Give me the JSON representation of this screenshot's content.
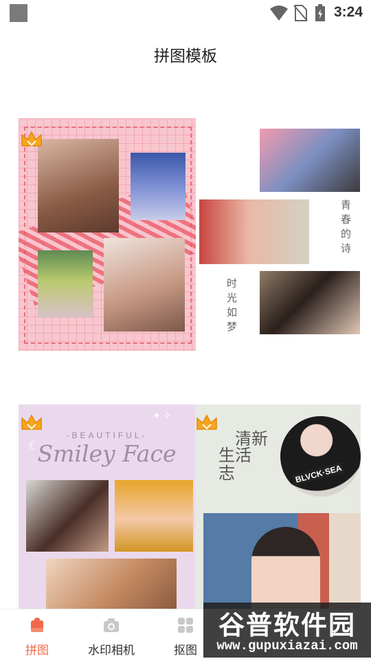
{
  "status_bar": {
    "time": "3:24"
  },
  "header": {
    "title": "拼图模板"
  },
  "template1": {
    "right_text_1": "青春的诗",
    "right_text_2": "时光如梦"
  },
  "template2": {
    "caption_small": "-BEAUTIFUL-",
    "caption_large": "Smiley Face",
    "right_text_a": "清新",
    "right_text_b": "生活",
    "right_text_c": "志",
    "shirt_text": "BLVCK·SEA"
  },
  "bottom_nav": {
    "items": [
      {
        "label": "拼图",
        "icon": "puzzle-icon",
        "active": true
      },
      {
        "label": "水印相机",
        "icon": "camera-icon",
        "active": false
      },
      {
        "label": "抠图",
        "icon": "grid-icon",
        "active": false
      }
    ]
  },
  "watermark": {
    "title": "谷普软件园",
    "url": "www.gupuxiazai.com"
  },
  "colors": {
    "accent": "#f06a4a",
    "pink_template": "#f8c6cf",
    "lavender_template": "#ead9ec"
  }
}
